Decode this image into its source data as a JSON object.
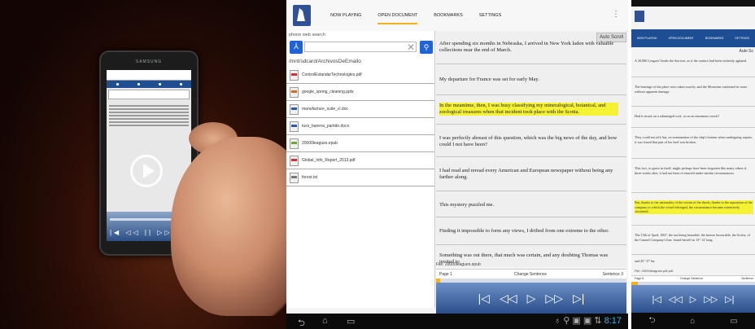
{
  "video": {
    "phone_brand": "SAMSUNG",
    "play_label": "Play video",
    "mini_controls": "|◀ ◁◁ || ▷▷ ▶|"
  },
  "tablet": {
    "tabs": [
      "NOW PLAYING",
      "OPEN DOCUMENT",
      "BOOKMARKS",
      "SETTINGS"
    ],
    "search_label": "phone web search",
    "search_placeholder": "",
    "path": "/mnt/sdcard/ArchivosDeEmailo",
    "files": [
      {
        "name": "ControlEstandarTechnologies.pdf",
        "icon": "pdf"
      },
      {
        "name": "google_spring_cleaning.pptx",
        "icon": "ppt"
      },
      {
        "name": "manufacture_suite_ci.doc",
        "icon": "doc"
      },
      {
        "name": "tuxs_barerra_partido.docx",
        "icon": "doc"
      },
      {
        "name": "20000leagues.epub",
        "icon": "epub"
      },
      {
        "name": "Global_Info_Report_2013.pdf",
        "icon": "pdf"
      },
      {
        "name": "forest.txt",
        "icon": "txt"
      }
    ],
    "auto_scroll": "Auto Scroll",
    "paragraphs": [
      {
        "text": "After spending six months in Nebraska, I arrived in New York laden with valuable collections near the end of March.",
        "highlight": false
      },
      {
        "text": "My departure for France was set for early May.",
        "highlight": false
      },
      {
        "text": "In the meantime, then, I was busy classifying my mineralogical, botanical, and zoological treasures when that incident took place with the Scotia.",
        "highlight": true
      },
      {
        "text": "I was perfectly abreast of this question, which was the big news of the day, and how could I not have been?",
        "highlight": false
      },
      {
        "text": "I had read and reread every American and European newspaper without being any farther along.",
        "highlight": false
      },
      {
        "text": "This mystery puzzled me.",
        "highlight": false
      },
      {
        "text": "Finding it impossible to form any views, I drifted from one extreme to the other.",
        "highlight": false
      },
      {
        "text": "Something was out there, that much was certain, and any doubting Thomas was invited to",
        "highlight": false
      }
    ],
    "file_line": "File: 20000leagues.epub",
    "page_label": "Page 1",
    "change_sentence": "Change Sentence",
    "sentence_label": "Sentence 3",
    "progress": 0.02,
    "clock": "8:17",
    "controls": [
      "|◁",
      "◁◁",
      "▷",
      "▷▷",
      "▷|"
    ],
    "nav": [
      "⮌",
      "⌂",
      "▭"
    ],
    "status_icons": "♁ ⚲ ▣ ▣ ⇅"
  },
  "phone": {
    "tabs": [
      "NOW PLAYING",
      "OPEN DOCUMENT",
      "BOOKMARKS",
      "SETTINGS"
    ],
    "auto_scroll": "Auto Sc",
    "paragraphs": [
      {
        "text": "A 20,000 Leagues Under the Sea text, as if the surface had been violently agitated.",
        "highlight": false
      },
      {
        "text": "The bearings of the place were taken exactly, and the Moravian continued its route without apparent damage.",
        "highlight": false
      },
      {
        "text": "Had it struck on a submerged rock, or on an enormous wreck?",
        "highlight": false
      },
      {
        "text": "They could not tell; but, on examination of the ship's bottom when undergoing repairs, it was found that part of her keel was broken.",
        "highlight": false
      },
      {
        "text": "This fact, so grave in itself, might perhaps have been forgotten like many others if, three weeks after, it had not been re-enacted under similar circumstances.",
        "highlight": false
      },
      {
        "text": "But, thanks to the nationality of the victim of the shock, thanks to the reputation of the company to which the vessel belonged, the circumstance became extensively circulated.",
        "highlight": true
      },
      {
        "text": "The 13th of April, 1867, the sea being beautiful, the breeze favourable, the Scotia, of the Cunard Company's line, found herself in 15° 12' long.",
        "highlight": false
      },
      {
        "text": "and 45° 37' lat.",
        "highlight": false
      }
    ],
    "file_line": "File: 20000leagues.pdf.pdf",
    "page_label": "Page 8",
    "change_sentence": "Change Sentence",
    "sentence_label": "Sentence",
    "progress": 0.05,
    "controls": [
      "|◁",
      "◁◁",
      "▷",
      "▷▷",
      "▷|"
    ],
    "nav": [
      "⮌",
      "⌂",
      "▭"
    ]
  }
}
